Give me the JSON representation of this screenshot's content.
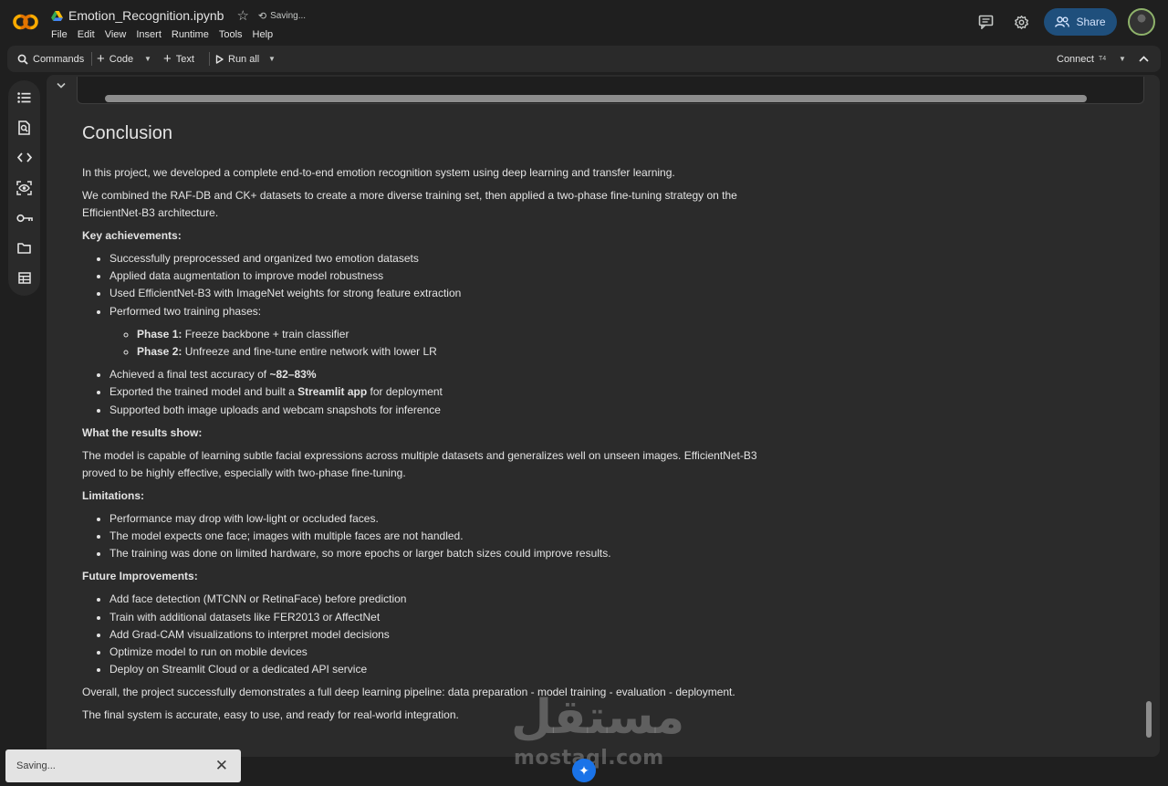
{
  "header": {
    "notebook_name": "Emotion_Recognition.ipynb",
    "saving_status": "Saving...",
    "menu": [
      "File",
      "Edit",
      "View",
      "Insert",
      "Runtime",
      "Tools",
      "Help"
    ],
    "share_label": "Share"
  },
  "toolbar": {
    "commands": "Commands",
    "code": "Code",
    "text": "Text",
    "run_all": "Run all",
    "connect": "Connect",
    "runtime_type": "T4"
  },
  "markdown": {
    "heading": "Conclusion",
    "intro_1": "In this project, we developed a complete end-to-end emotion recognition system using deep learning and transfer learning.",
    "intro_2": "We combined the RAF-DB and CK+ datasets to create a more diverse training set, then applied a two-phase fine-tuning strategy on the EfficientNet-B3 architecture.",
    "key_title": "Key achievements:",
    "key_items": [
      "Successfully preprocessed and organized two emotion datasets",
      "Applied data augmentation to improve model robustness",
      "Used EfficientNet-B3 with ImageNet weights for strong feature extraction",
      "Performed two training phases:"
    ],
    "phase_1_label": "Phase 1:",
    "phase_1_text": " Freeze backbone + train classifier",
    "phase_2_label": "Phase 2:",
    "phase_2_text": " Unfreeze and fine-tune entire network with lower LR",
    "accuracy_prefix": "Achieved a final test accuracy of ",
    "accuracy_value": "~82–83%",
    "export_prefix": "Exported the trained model and built a ",
    "export_bold": "Streamlit app",
    "export_suffix": " for deployment",
    "support_item": "Supported both image uploads and webcam snapshots for inference",
    "results_title": "What the results show:",
    "results_text": "The model is capable of learning subtle facial expressions across multiple datasets and generalizes well on unseen images. EfficientNet-B3 proved to be highly effective, especially with two-phase fine-tuning.",
    "limitations_title": "Limitations:",
    "limitations": [
      "Performance may drop with low-light or occluded faces.",
      "The model expects one face; images with multiple faces are not handled.",
      "The training was done on limited hardware, so more epochs or larger batch sizes could improve results."
    ],
    "future_title": "Future Improvements:",
    "future": [
      "Add face detection (MTCNN or RetinaFace) before prediction",
      "Train with additional datasets like FER2013 or AffectNet",
      "Add Grad-CAM visualizations to interpret model decisions",
      "Optimize model to run on mobile devices",
      "Deploy on Streamlit Cloud or a dedicated API service"
    ],
    "overall_1": "Overall, the project successfully demonstrates a full deep learning pipeline: data preparation - model training - evaluation - deployment.",
    "overall_2": "The final system is accurate, easy to use, and ready for real-world integration."
  },
  "toast": {
    "text": "Saving..."
  },
  "watermark": {
    "arabic": "مستقل",
    "latin": "mostaql.com"
  },
  "colors": {
    "accent": "#1f4f7c",
    "background": "#1f1f1f",
    "panel": "#2b2b2b"
  }
}
